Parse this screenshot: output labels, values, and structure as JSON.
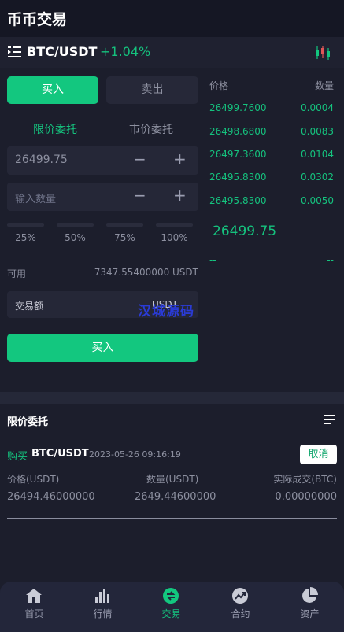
{
  "header": {
    "title": "币币交易"
  },
  "pair": {
    "name": "BTC/USDT",
    "change": "+1.04%"
  },
  "trade": {
    "buy_tab": "买入",
    "sell_tab": "卖出",
    "limit_order": "限价委托",
    "market_order": "市价委托",
    "price_value": "26499.75",
    "quantity_placeholder": "输入数量",
    "minus": "−",
    "plus": "+",
    "percentages": [
      "25%",
      "50%",
      "75%",
      "100%"
    ],
    "available_label": "可用",
    "available_value": "7347.55400000 USDT",
    "amount_label": "交易额",
    "amount_unit": "USDT",
    "submit_label": "买入"
  },
  "watermark": "汉城源码",
  "orderbook": {
    "price_header": "价格",
    "quantity_header": "数量",
    "rows": [
      {
        "price": "26499.7600",
        "quantity": "0.0004"
      },
      {
        "price": "26498.6800",
        "quantity": "0.0083"
      },
      {
        "price": "26497.3600",
        "quantity": "0.0104"
      },
      {
        "price": "26495.8300",
        "quantity": "0.0302"
      },
      {
        "price": "26495.8300",
        "quantity": "0.0050"
      }
    ],
    "last_price": "26499.75",
    "dash_left": "--",
    "dash_right": "--"
  },
  "orders": {
    "title": "限价委托",
    "item": {
      "side": "购买",
      "pair": "BTC/USDT",
      "time": "2023-05-26 09:16:19",
      "cancel_label": "取消",
      "price_label": "价格(USDT)",
      "quantity_label": "数量(USDT)",
      "filled_label": "实际成交(BTC)",
      "price_value": "26494.46000000",
      "quantity_value": "2649.44600000",
      "filled_value": "0.00000000"
    }
  },
  "tabbar": {
    "items": [
      {
        "label": "首页",
        "icon": "home-icon"
      },
      {
        "label": "行情",
        "icon": "market-chart-icon"
      },
      {
        "label": "交易",
        "icon": "trade-icon"
      },
      {
        "label": "合约",
        "icon": "contract-trend-icon"
      },
      {
        "label": "资产",
        "icon": "assets-pie-icon"
      }
    ],
    "active_index": 2
  },
  "colors": {
    "accent": "#13c77f",
    "background": "#1c1e2c",
    "header": "#151724"
  }
}
